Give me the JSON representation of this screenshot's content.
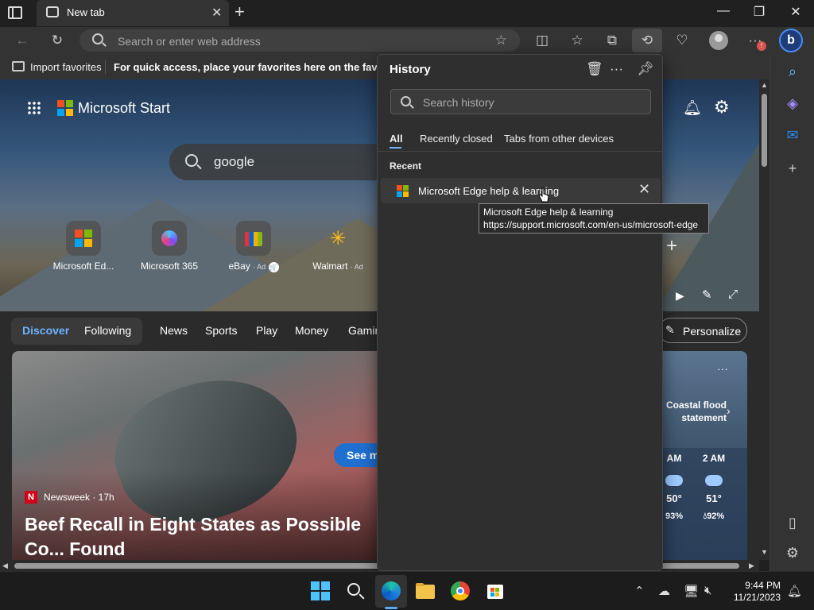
{
  "browser": {
    "tab_title": "New tab",
    "address_placeholder": "Search or enter web address"
  },
  "favorites_bar": {
    "import_label": "Import favorites",
    "hint": "For quick access, place your favorites here on the favorites ba"
  },
  "page": {
    "brand": "Microsoft Start",
    "search_value": "google",
    "quick_links": [
      {
        "label": "Microsoft Ed...",
        "ad": ""
      },
      {
        "label": "Microsoft 365",
        "ad": ""
      },
      {
        "label": "eBay",
        "ad": "· Ad"
      },
      {
        "label": "Walmart",
        "ad": "· Ad"
      }
    ],
    "nav": {
      "discover": "Discover",
      "following": "Following",
      "items": [
        "News",
        "Sports",
        "Play",
        "Money",
        "Gamin"
      ],
      "personalize": "Personalize"
    },
    "news": {
      "source": "Newsweek · 17h",
      "source_logo": "N",
      "headline": "Beef Recall in Eight States as Possible Co... Found",
      "see_more": "See m"
    },
    "weather": {
      "alert": "Coastal flood statement",
      "hours": [
        {
          "time": "AM",
          "temp": "50°",
          "humidity": "93%"
        },
        {
          "time": "2 AM",
          "temp": "51°",
          "humidity": "92%"
        }
      ]
    }
  },
  "history": {
    "title": "History",
    "search_placeholder": "Search history",
    "tabs": [
      "All",
      "Recently closed",
      "Tabs from other devices"
    ],
    "section": "Recent",
    "item": {
      "title": "Microsoft Edge help & learning"
    },
    "tooltip": {
      "title": "Microsoft Edge help & learning",
      "url": "https://support.microsoft.com/en-us/microsoft-edge"
    }
  },
  "toolbar": {
    "notification_badge": "!"
  },
  "taskbar": {
    "time": "9:44 PM",
    "date": "11/21/2023"
  },
  "colors": {
    "accent": "#5ca9f2",
    "ms_red": "#f25022",
    "ms_green": "#7fba00",
    "ms_blue": "#00a4ef",
    "ms_yellow": "#ffb900"
  }
}
